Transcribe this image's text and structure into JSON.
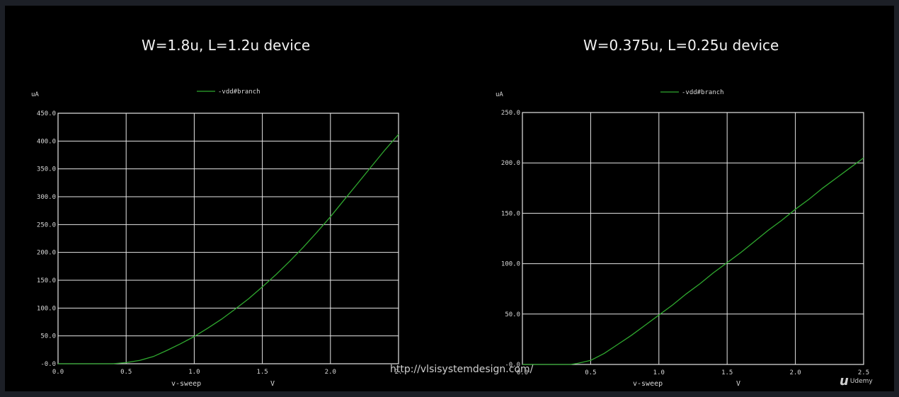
{
  "watermark": {
    "url": "http://vlsisystemdesign.com/",
    "brand": "Udemy",
    "brand_mark": "u"
  },
  "chart_data": [
    {
      "type": "line",
      "title": "W=1.8u, L=1.2u device",
      "ylabel": "uA",
      "xlabel": "v-sweep",
      "xunit": "V",
      "xlim": [
        0,
        2.5
      ],
      "ylim": [
        0,
        450
      ],
      "grid": true,
      "legend_placement": "top-center",
      "x_tick_labels": [
        "0.0",
        "0.5",
        "1.0",
        "1.5",
        "2.0",
        "2."
      ],
      "y_tick_labels": [
        "-0.0",
        "50.0",
        "100.0",
        "150.0",
        "200.0",
        "250.0",
        "300.0",
        "350.0",
        "400.0",
        "450.0"
      ],
      "line_color": "#2fa82f",
      "series": [
        {
          "name": "-vdd#branch",
          "x": [
            0.4,
            0.5,
            0.6,
            0.7,
            0.8,
            0.9,
            1.0,
            1.1,
            1.2,
            1.3,
            1.4,
            1.5,
            1.6,
            1.7,
            1.8,
            1.9,
            2.0,
            2.1,
            2.2,
            2.3,
            2.4,
            2.5
          ],
          "y": [
            0,
            2,
            6,
            13,
            24,
            36,
            49,
            64,
            80,
            98,
            117,
            138,
            160,
            184,
            209,
            236,
            264,
            294,
            324,
            354,
            384,
            412
          ]
        }
      ]
    },
    {
      "type": "line",
      "title": "W=0.375u, L=0.25u device",
      "ylabel": "uA",
      "xlabel": "v-sweep",
      "xunit": "V",
      "xlim": [
        0,
        2.5
      ],
      "ylim": [
        0,
        250
      ],
      "grid": true,
      "legend_placement": "top-center",
      "x_tick_labels": [
        "0.0",
        "0.5",
        "1.0",
        "1.5",
        "2.0",
        "2.5"
      ],
      "y_tick_labels": [
        "-0.0",
        "50.0",
        "100.0",
        "150.0",
        "200.0",
        "250.0"
      ],
      "line_color": "#2fa82f",
      "series": [
        {
          "name": "-vdd#branch",
          "x": [
            0.35,
            0.4,
            0.5,
            0.6,
            0.7,
            0.8,
            0.9,
            1.0,
            1.1,
            1.2,
            1.3,
            1.4,
            1.5,
            1.6,
            1.7,
            1.8,
            1.9,
            2.0,
            2.1,
            2.2,
            2.3,
            2.4,
            2.5
          ],
          "y": [
            0,
            1,
            4,
            11,
            20,
            29,
            39,
            49,
            59,
            70,
            80,
            91,
            101,
            111,
            122,
            133,
            143,
            154,
            164,
            175,
            185,
            195,
            205
          ]
        }
      ]
    }
  ]
}
